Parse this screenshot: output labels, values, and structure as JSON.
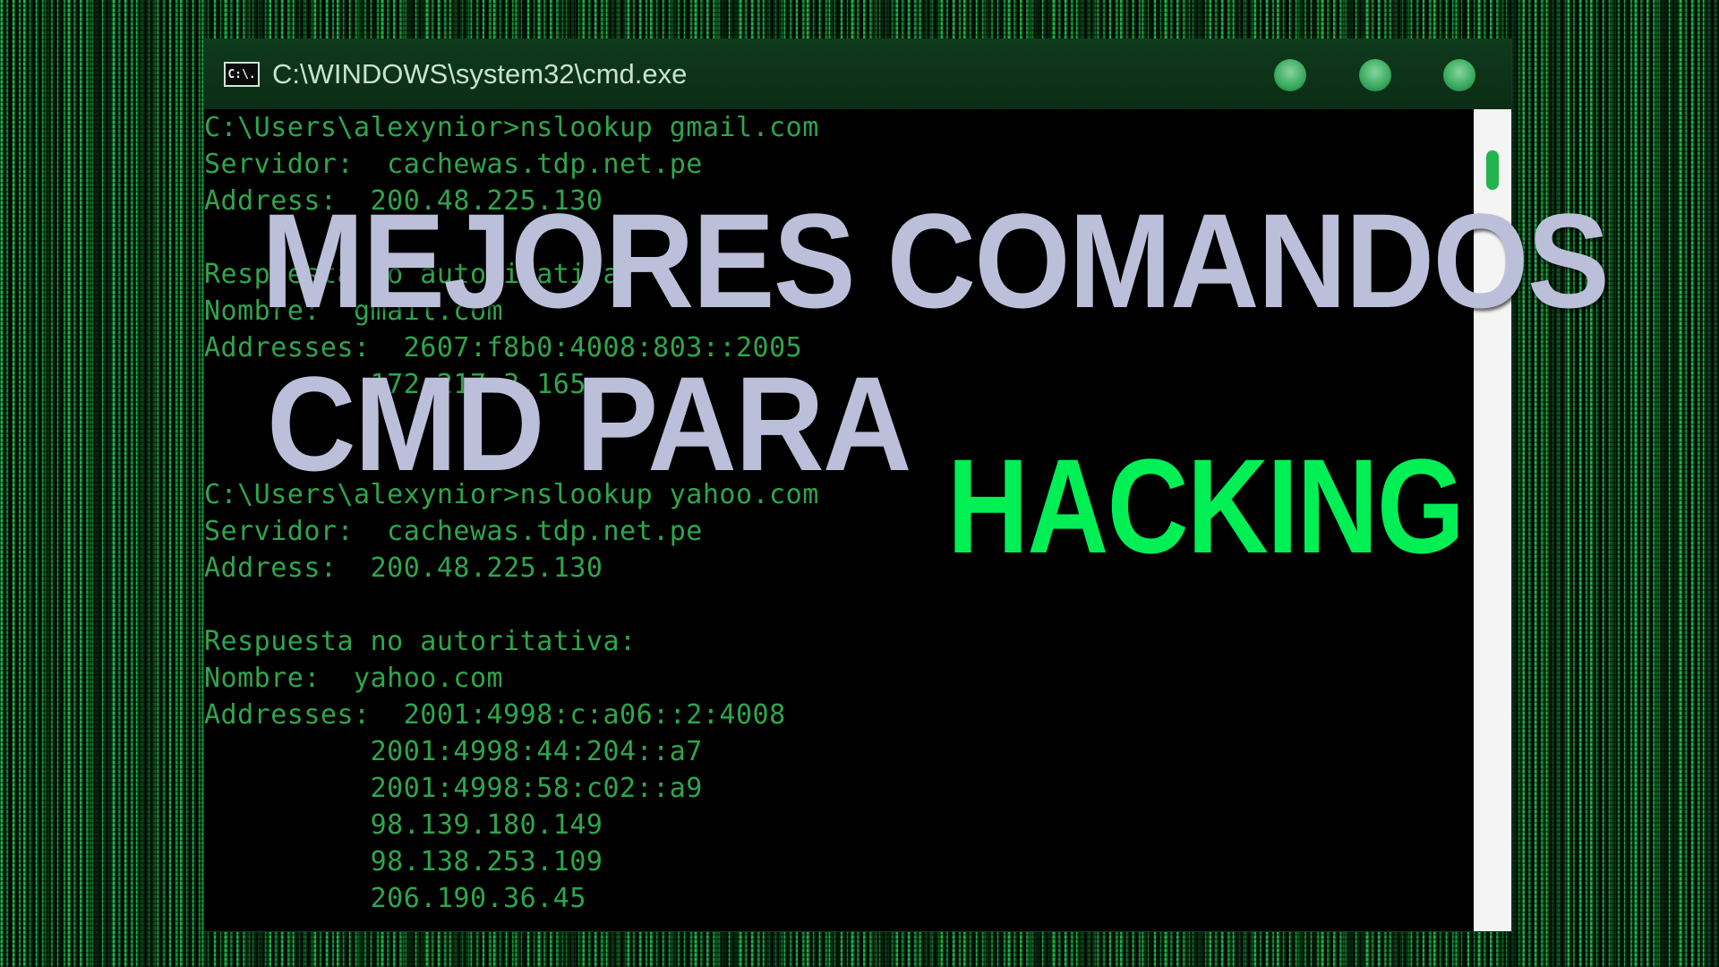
{
  "window": {
    "title": "C:\\WINDOWS\\system32\\cmd.exe",
    "icon_label": "C:\\.",
    "icon": "cmd-icon",
    "buttons": [
      "minimize-icon",
      "maximize-icon",
      "close-icon"
    ]
  },
  "console": {
    "lines": [
      "C:\\Users\\alexynior>nslookup gmail.com",
      "Servidor:  cachewas.tdp.net.pe",
      "Address:  200.48.225.130",
      "",
      "Respuesta no autoritativa:",
      "Nombre:  gmail.com",
      "Addresses:  2607:f8b0:4008:803::2005",
      "          172.217.3.165",
      "",
      "",
      "C:\\Users\\alexynior>nslookup yahoo.com",
      "Servidor:  cachewas.tdp.net.pe",
      "Address:  200.48.225.130",
      "",
      "Respuesta no autoritativa:",
      "Nombre:  yahoo.com",
      "Addresses:  2001:4998:c:a06::2:4008",
      "          2001:4998:44:204::a7",
      "          2001:4998:58:c02::a9",
      "          98.139.180.149",
      "          98.138.253.109",
      "          206.190.36.45"
    ]
  },
  "headline": {
    "line1": "MEJORES COMANDOS",
    "line2": "CMD PARA",
    "line3": "HACKING"
  },
  "colors": {
    "console_text": "#2fa54c",
    "headline_text": "#bcbfd9",
    "accent": "#00ef55",
    "titlebar": "#0f3a1c"
  }
}
